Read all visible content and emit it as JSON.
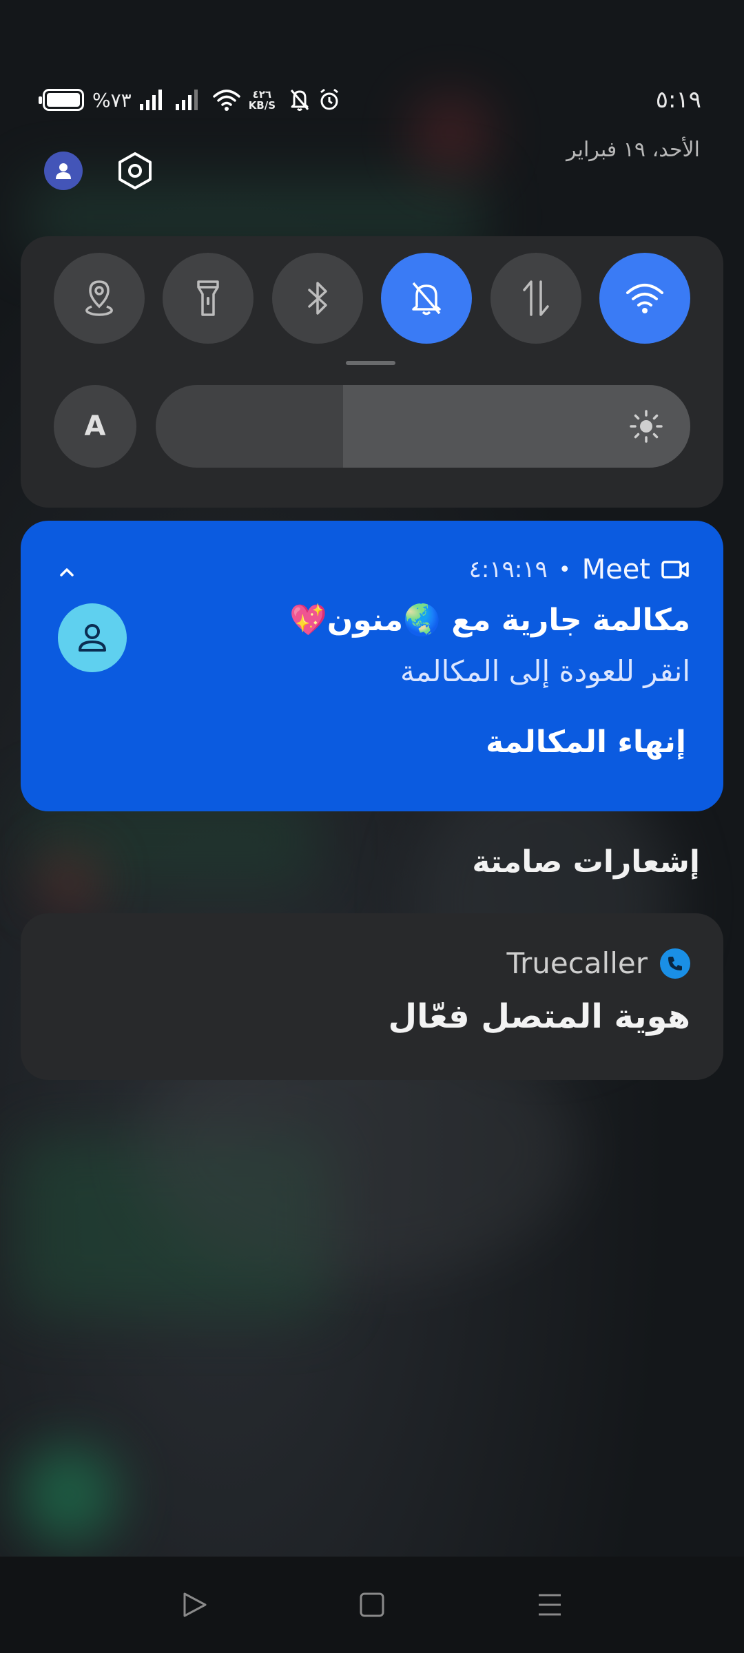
{
  "status_bar": {
    "time": "٥:١٩",
    "battery_percent": "%٧٣",
    "battery_level": 0.73,
    "network_speed_value": "٤٢٦",
    "network_speed_unit": "KB/S",
    "icons": [
      "battery-icon",
      "signal-icon",
      "signal-icon",
      "wifi-icon",
      "mute-icon",
      "alarm-icon"
    ]
  },
  "date": "الأحد، ١٩ فبراير",
  "quick_settings": {
    "tiles": [
      {
        "name": "location",
        "icon": "location-icon",
        "active": false
      },
      {
        "name": "flashlight",
        "icon": "flashlight-icon",
        "active": false
      },
      {
        "name": "bluetooth",
        "icon": "bluetooth-icon",
        "active": false
      },
      {
        "name": "do-not-disturb",
        "icon": "bell-off-icon",
        "active": true
      },
      {
        "name": "mobile-data",
        "icon": "data-transfer-icon",
        "active": false
      },
      {
        "name": "wifi",
        "icon": "wifi-icon",
        "active": true
      }
    ],
    "auto_brightness_label": "A",
    "brightness_level": 0.35,
    "accent_color": "#3a7bf5"
  },
  "meet_notification": {
    "app_name": "Meet",
    "separator": "•",
    "timestamp": "٤:١٩:١٩",
    "title": "مكالمة جارية مع 🌏منون💖",
    "subtitle": "انقر للعودة إلى المكالمة",
    "action_label": "إنهاء المكالمة",
    "background_color": "#0b5be0"
  },
  "silent_section_label": "إشعارات صامتة",
  "truecaller_notification": {
    "app_name": "Truecaller",
    "text": "هوية المتصل فعّال"
  },
  "navigation": [
    "back-icon",
    "home-icon",
    "menu-icon"
  ]
}
